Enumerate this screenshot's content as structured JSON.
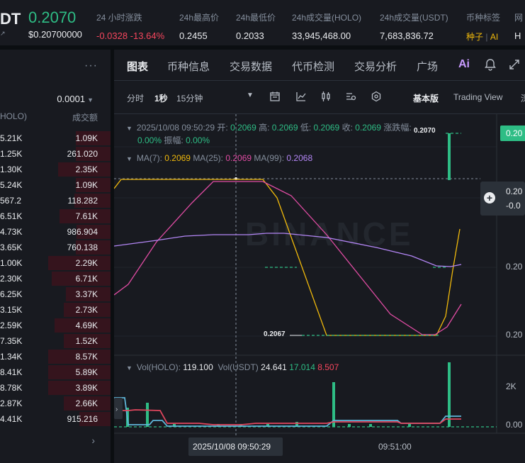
{
  "header": {
    "pair": "DT",
    "pair_sub": "↗",
    "last_price": "0.2070",
    "last_price_usd": "$0.20700000",
    "stats": [
      {
        "label": "24 小时涨跌",
        "value": "-0.0328 -13.64%"
      },
      {
        "label": "24h最高价",
        "value": "0.2455"
      },
      {
        "label": "24h最低价",
        "value": "0.2033"
      },
      {
        "label": "24h成交量(HOLO)",
        "value": "33,945,468.00"
      },
      {
        "label": "24h成交量(USDT)",
        "value": "7,683,836.72"
      }
    ],
    "tags_label": "币种标签",
    "tags": [
      "种子",
      "AI"
    ],
    "tags_sep": "|",
    "cut_label": "网",
    "cut_value": "H"
  },
  "orderbook": {
    "more_icon": "more-dots-icon",
    "precision": "0.0001",
    "col1": "HOLO)",
    "col2": "成交额",
    "rows": [
      {
        "c1": "5.21K",
        "c2": "1.09K",
        "depth": 0.56
      },
      {
        "c1": "1.25K",
        "c2": "261.020",
        "depth": 0.56
      },
      {
        "c1": "1.30K",
        "c2": "2.35K",
        "depth": 0.84
      },
      {
        "c1": "5.24K",
        "c2": "1.09K",
        "depth": 0.56
      },
      {
        "c1": "567.2",
        "c2": "118.282",
        "depth": 0.58
      },
      {
        "c1": "6.51K",
        "c2": "7.61K",
        "depth": 0.82
      },
      {
        "c1": "4.73K",
        "c2": "986.904",
        "depth": 0.54
      },
      {
        "c1": "3.65K",
        "c2": "760.138",
        "depth": 0.56
      },
      {
        "c1": "1.00K",
        "c2": "2.29K",
        "depth": 1.0
      },
      {
        "c1": "2.30K",
        "c2": "6.71K",
        "depth": 0.94
      },
      {
        "c1": "6.25K",
        "c2": "3.37K",
        "depth": 0.72
      },
      {
        "c1": "3.15K",
        "c2": "2.73K",
        "depth": 0.75
      },
      {
        "c1": "2.59K",
        "c2": "4.69K",
        "depth": 0.9
      },
      {
        "c1": "7.35K",
        "c2": "1.52K",
        "depth": 0.75
      },
      {
        "c1": "1.34K",
        "c2": "8.57K",
        "depth": 1.0
      },
      {
        "c1": "8.41K",
        "c2": "5.89K",
        "depth": 1.0
      },
      {
        "c1": "8.78K",
        "c2": "3.89K",
        "depth": 1.0
      },
      {
        "c1": "2.87K",
        "c2": "2.66K",
        "depth": 0.75
      },
      {
        "c1": "4.41K",
        "c2": "915.216",
        "depth": 0.5
      }
    ]
  },
  "tabs": [
    "图表",
    "币种信息",
    "交易数据",
    "代币检测",
    "交易分析",
    "广场"
  ],
  "tab_ai": "Ai",
  "toolbar": {
    "intervals": [
      "分时",
      "1秒",
      "15分钟"
    ],
    "active_interval": "1秒",
    "views": [
      "基本版",
      "Trading View",
      "深"
    ],
    "active_view": "基本版"
  },
  "legend": {
    "datetime": "2025/10/08 09:50:29",
    "open_label": "开:",
    "open": "0.2069",
    "high_label": "高:",
    "high": "0.2069",
    "low_label": "低:",
    "low": "0.2069",
    "close_label": "收:",
    "close": "0.2069",
    "change_label": "涨跌幅:",
    "change": "0.00%",
    "amp_label": "振幅:",
    "amp": "0.00%",
    "ma7_label": "MA(7):",
    "ma7": "0.2069",
    "ma25_label": "MA(25):",
    "ma25": "0.2069",
    "ma99_label": "MA(99):",
    "ma99": "0.2068",
    "vol_label": "Vol(HOLO):",
    "vol": "119.100",
    "volu_label": "Vol(USDT)",
    "volu": "24.641",
    "volu2": "17.014",
    "volu3": "8.507"
  },
  "chart_marks": {
    "price_tag": "0.20",
    "cross_price": "0.20",
    "cross_change": "-0.0",
    "axis_1": "0.20",
    "axis_2": "0.20",
    "vol_axis_1": "2K",
    "vol_axis_2": "0.00",
    "low_label": "0.2067",
    "high_label": "0.2070",
    "crosshair_time": "2025/10/08 09:50:29",
    "time_tick": "09:51:00",
    "watermark": "BINANCE"
  },
  "colors": {
    "up": "#2ebd85",
    "down": "#f6465d",
    "ma7": "#f0b90b",
    "ma25": "#e04ca3",
    "ma99": "#b386f5",
    "vol_usdt_1": "#5fb6d9",
    "vol_usdt_2": "#e0465d"
  }
}
